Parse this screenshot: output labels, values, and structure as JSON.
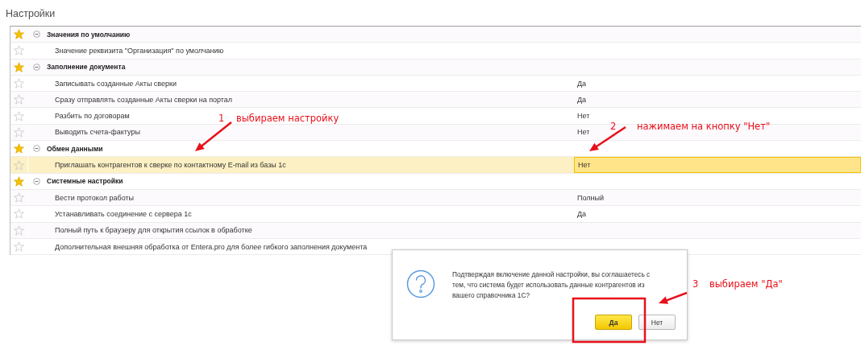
{
  "window": {
    "title": "Настройки"
  },
  "groups": [
    {
      "label": "Значения по умолчанию",
      "starred": true,
      "expanded": true,
      "children": [
        {
          "label": "Значение реквизита \"Организация\" по умолчанию",
          "starred": false,
          "selected": false
        }
      ]
    },
    {
      "label": "Заполнение документа",
      "starred": true,
      "expanded": true,
      "children": [
        {
          "label": "Записывать созданные Акты сверки",
          "value": "Да",
          "starred": false,
          "selected": false
        },
        {
          "label": "Сразу отправлять созданные Акты сверки на портал",
          "value": "Да",
          "starred": false,
          "selected": false
        },
        {
          "label": "Разбить по договорам",
          "value": "Нет",
          "starred": false,
          "selected": false
        },
        {
          "label": "Выводить счета-фактуры",
          "value": "Нет",
          "starred": false,
          "selected": false
        }
      ]
    },
    {
      "label": "Обмен данными",
      "starred": true,
      "expanded": true,
      "children": [
        {
          "label": "Приглашать контрагентов к сверке по контактному E-mail из базы 1с",
          "value": "Нет",
          "starred": false,
          "selected": true
        }
      ]
    },
    {
      "label": "Системные настройки",
      "starred": true,
      "expanded": true,
      "children": [
        {
          "label": "Вести протокол работы",
          "value": "Полный",
          "starred": false,
          "selected": false
        },
        {
          "label": "Устанавливать соединение с сервера 1с",
          "value": "Да",
          "starred": false,
          "selected": false
        },
        {
          "label": "Полный путь к браузеру для открытия ссылок в обработке",
          "starred": false,
          "selected": false
        },
        {
          "label": "Дополнительная внешняя обработка от Entera.pro для более гибкого заполнения документа",
          "starred": false,
          "selected": false
        }
      ]
    }
  ],
  "dialog": {
    "message": "Подтверждая включение данной настройки, вы соглашаетесь с тем, что система будет использовать данные контрагентов из вашего справочника 1С?",
    "buttons": [
      {
        "label": "Да",
        "default": true
      },
      {
        "label": "Нет",
        "default": false
      }
    ]
  },
  "annotations": [
    {
      "number": "1",
      "text": "выбираем настройку"
    },
    {
      "number": "2",
      "text": "нажимаем на кнопку \"Нет\""
    },
    {
      "number": "3",
      "text": "выбираем \"Да\""
    }
  ]
}
